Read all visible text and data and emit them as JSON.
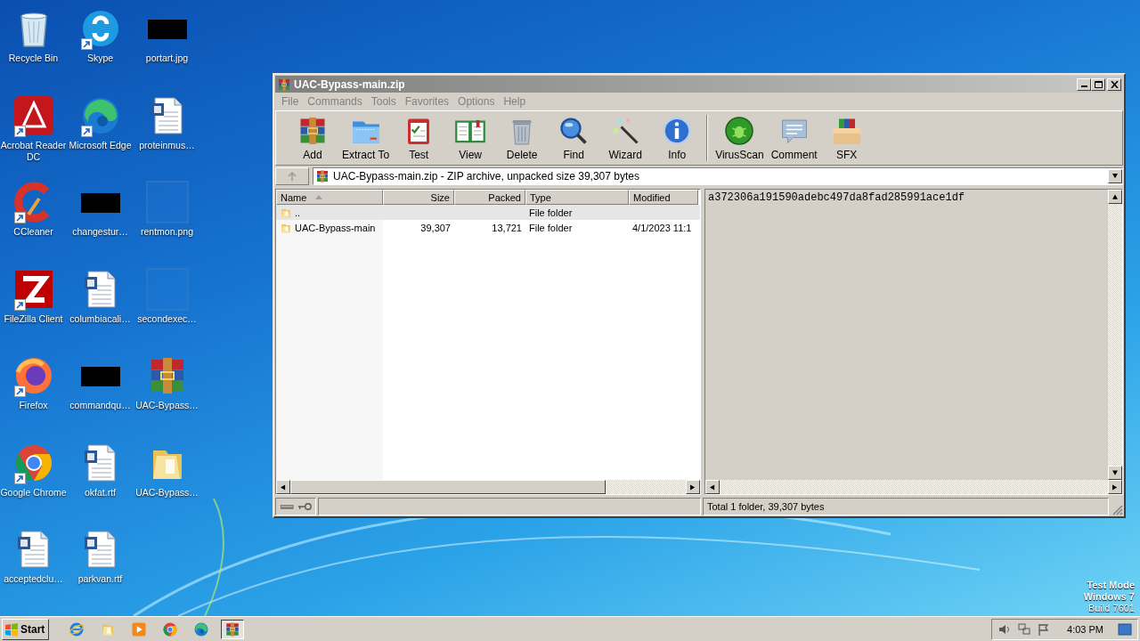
{
  "desktop": {
    "icons": [
      {
        "label": "Recycle Bin",
        "kind": "recycle",
        "shortcut": false
      },
      {
        "label": "Acrobat Reader DC",
        "kind": "acrobat",
        "shortcut": true
      },
      {
        "label": "CCleaner",
        "kind": "ccleaner",
        "shortcut": true
      },
      {
        "label": "FileZilla Client",
        "kind": "filezilla",
        "shortcut": true
      },
      {
        "label": "Firefox",
        "kind": "firefox",
        "shortcut": true
      },
      {
        "label": "Google Chrome",
        "kind": "chrome",
        "shortcut": true
      },
      {
        "label": "acceptedclu…",
        "kind": "word",
        "shortcut": false
      },
      {
        "label": "Skype",
        "kind": "skype",
        "shortcut": true
      },
      {
        "label": "Microsoft Edge",
        "kind": "edge",
        "shortcut": true
      },
      {
        "label": "changestur…",
        "kind": "redacted",
        "shortcut": false
      },
      {
        "label": "columbiacali…",
        "kind": "word",
        "shortcut": false
      },
      {
        "label": "commandqu…",
        "kind": "redacted",
        "shortcut": false
      },
      {
        "label": "okfat.rtf",
        "kind": "word",
        "shortcut": false
      },
      {
        "label": "parkvan.rtf",
        "kind": "word",
        "shortcut": false
      },
      {
        "label": "portart.jpg",
        "kind": "redacted",
        "shortcut": false
      },
      {
        "label": "proteinmus…",
        "kind": "word",
        "shortcut": false
      },
      {
        "label": "rentmon.png",
        "kind": "blank",
        "shortcut": false
      },
      {
        "label": "secondexec…",
        "kind": "blank",
        "shortcut": false
      },
      {
        "label": "UAC-Bypass…",
        "kind": "winrar",
        "shortcut": false
      },
      {
        "label": "UAC-Bypass…",
        "kind": "folder",
        "shortcut": false
      }
    ],
    "os_notice": [
      {
        "text": "Test Mode",
        "bold": true
      },
      {
        "text": "Windows 7",
        "bold": true
      },
      {
        "text": "Build 7601",
        "bold": false
      }
    ]
  },
  "window": {
    "title": "UAC-Bypass-main.zip",
    "menu": [
      "File",
      "Commands",
      "Tools",
      "Favorites",
      "Options",
      "Help"
    ],
    "toolbar": [
      {
        "label": "Add",
        "kind": "add",
        "separator_before": false
      },
      {
        "label": "Extract To",
        "kind": "extract",
        "separator_before": false
      },
      {
        "label": "Test",
        "kind": "test",
        "separator_before": false
      },
      {
        "label": "View",
        "kind": "view",
        "separator_before": false
      },
      {
        "label": "Delete",
        "kind": "delete",
        "separator_before": false
      },
      {
        "label": "Find",
        "kind": "find",
        "separator_before": false
      },
      {
        "label": "Wizard",
        "kind": "wizard",
        "separator_before": false
      },
      {
        "label": "Info",
        "kind": "info",
        "separator_before": false
      },
      {
        "label": "VirusScan",
        "kind": "virusscan",
        "separator_before": true
      },
      {
        "label": "Comment",
        "kind": "comment",
        "separator_before": false
      },
      {
        "label": "SFX",
        "kind": "sfx",
        "separator_before": false
      }
    ],
    "address": "UAC-Bypass-main.zip - ZIP archive, unpacked size 39,307 bytes",
    "columns": [
      {
        "label": "Name",
        "sorted": true
      },
      {
        "label": "Size",
        "sorted": false
      },
      {
        "label": "Packed",
        "sorted": false
      },
      {
        "label": "Type",
        "sorted": false
      },
      {
        "label": "Modified",
        "sorted": false
      }
    ],
    "rows": [
      {
        "name": "..",
        "size": "",
        "packed": "",
        "type": "File folder",
        "modified": "",
        "selected": true
      },
      {
        "name": "UAC-Bypass-main",
        "size": "39,307",
        "packed": "13,721",
        "type": "File folder",
        "modified": "4/1/2023 11:1",
        "selected": false
      }
    ],
    "comment": "a372306a191590adebc497da8fad285991ace1df",
    "status": "Total 1 folder, 39,307 bytes"
  },
  "taskbar": {
    "start": "Start",
    "apps": [
      {
        "kind": "ie",
        "active": false
      },
      {
        "kind": "explorer",
        "active": false
      },
      {
        "kind": "media",
        "active": false
      },
      {
        "kind": "chrome",
        "active": false
      },
      {
        "kind": "edge",
        "active": false
      },
      {
        "kind": "winrar",
        "active": true
      }
    ],
    "clock": "4:03 PM"
  }
}
